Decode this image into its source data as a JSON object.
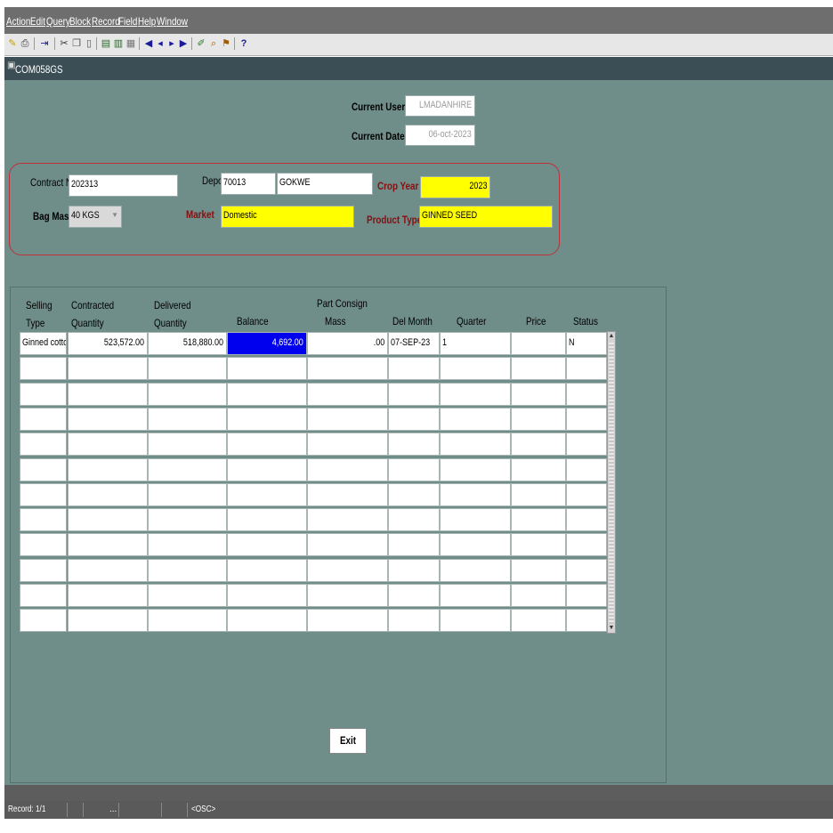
{
  "menu": [
    "Action",
    "Edit",
    "Query",
    "Block",
    "Record",
    "Field",
    "Help",
    "Window"
  ],
  "toolbar_icons": [
    "save-icon",
    "print-icon",
    "exit-icon",
    "cut-icon",
    "copy-icon",
    "paste-icon",
    "insert-record-icon",
    "delete-record-icon",
    "clear-record-icon",
    "first-record-icon",
    "prev-record-icon",
    "next-record-icon",
    "last-record-icon",
    "edit-icon",
    "query-icon",
    "execute-query-icon",
    "help-icon"
  ],
  "window": {
    "title": "COM058GS"
  },
  "header": {
    "current_user_label": "Current User",
    "current_user": "LMADANHIRE",
    "current_date_label": "Current Date",
    "current_date": "06-oct-2023"
  },
  "contract": {
    "contract_no_label": "Contract No",
    "contract_no": "202313",
    "depot_label": "Depot",
    "depot_code": "70013",
    "depot_name": "GOKWE",
    "crop_year_label": "Crop Year",
    "crop_year": "2023",
    "bag_mass_label": "Bag Mass",
    "bag_mass": "40 KGS",
    "market_label": "Market",
    "market": "Domestic",
    "product_type_label": "Product Type",
    "product_type": "GINNED SEED"
  },
  "grid": {
    "headers": {
      "selling_type": [
        "Selling",
        "Type"
      ],
      "contracted_qty": [
        "Contracted",
        "Quantity"
      ],
      "delivered_qty": [
        "Delivered",
        "Quantity"
      ],
      "balance": "Balance",
      "part_consign_mass": [
        "Part Consign",
        "Mass"
      ],
      "del_month": "Del Month",
      "quarter": "Quarter",
      "price": "Price",
      "status": "Status"
    },
    "rows": [
      {
        "selling_type": "Ginned cottons",
        "contracted_qty": "523,572.00",
        "delivered_qty": "518,880.00",
        "balance": "4,692.00",
        "part_consign_mass": ".00",
        "del_month": "07-SEP-23",
        "quarter": "1",
        "price": "",
        "status": "N"
      }
    ],
    "empty_rows": 11
  },
  "exit_button": "Exit",
  "status_bar": {
    "record": "Record: 1/1",
    "dots": "...",
    "mode": "<OSC>"
  },
  "colors": {
    "canvas": "#6f8d89",
    "required": "#ffff00",
    "selected": "#0000ee",
    "label_red": "#8a0d0d"
  }
}
